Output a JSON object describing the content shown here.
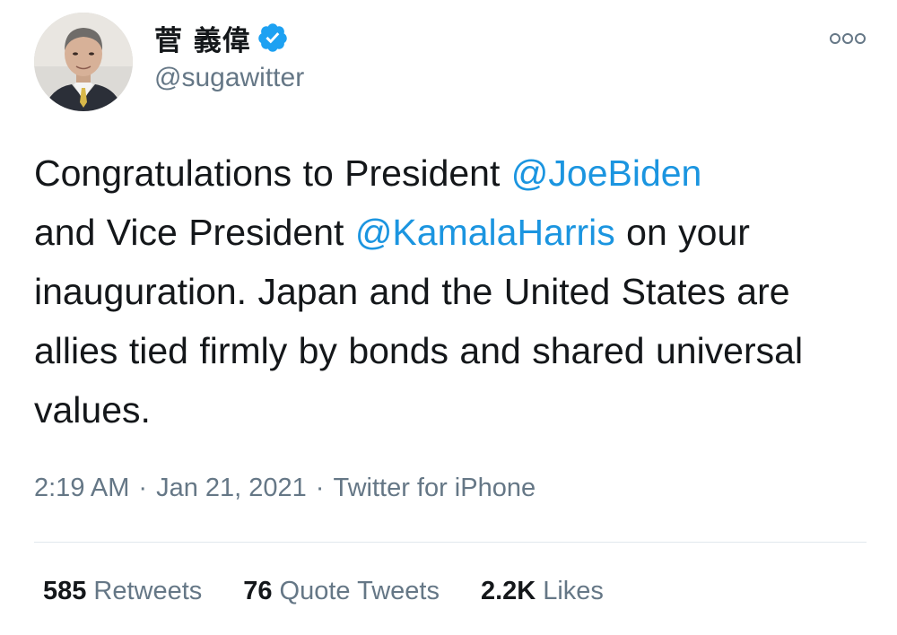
{
  "author": {
    "display_name": "菅 義偉",
    "handle": "@sugawitter",
    "verified": true,
    "avatar_icon": "avatar-portrait"
  },
  "tweet": {
    "text_1": "Congratulations to President ",
    "mention_1": "@JoeBiden",
    "text_2": " and Vice President ",
    "mention_2": "@KamalaHarris",
    "text_3": " on your inauguration. Japan and the United States are allies tied firmly by bonds and shared universal values."
  },
  "meta": {
    "time": "2:19 AM",
    "separator": "·",
    "date": "Jan 21, 2021",
    "source": "Twitter for iPhone"
  },
  "stats": {
    "retweets_count": "585",
    "retweets_label": "Retweets",
    "quotes_count": "76",
    "quotes_label": "Quote Tweets",
    "likes_count": "2.2K",
    "likes_label": "Likes"
  },
  "colors": {
    "link": "#1b95e0",
    "secondary_text": "#657786",
    "primary_text": "#14171a",
    "verified_badge": "#1da1f2",
    "divider": "#e1e8ed"
  },
  "icons": {
    "verified": "verified-badge-icon",
    "more": "more-options-icon"
  }
}
